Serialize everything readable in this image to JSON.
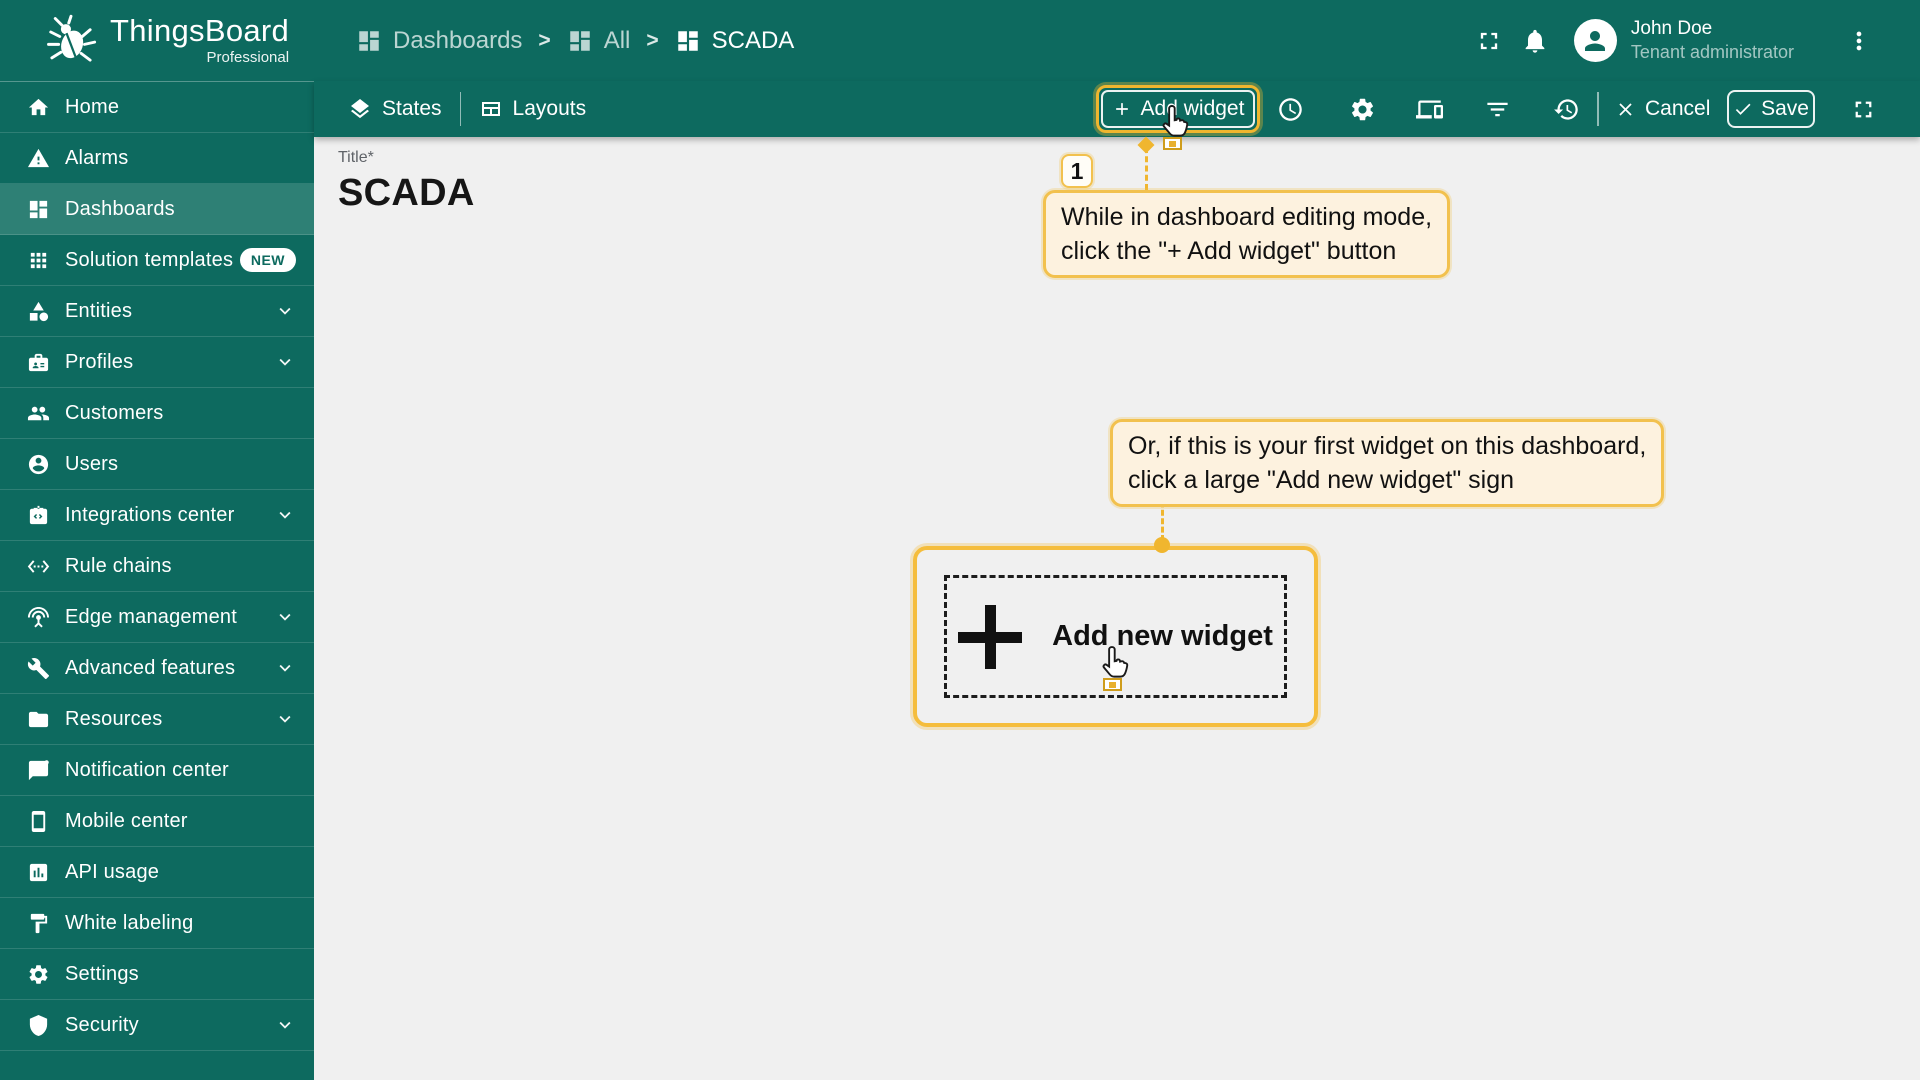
{
  "colors": {
    "primary_teal": "#0d6a5f",
    "selected_teal": "#2e8075",
    "accent_gold": "#f0b62f",
    "callout_bg": "#fdf2df",
    "callout_border": "#f2c14e",
    "content_bg": "#f0f0f0"
  },
  "header": {
    "logo": {
      "title": "ThingsBoard",
      "subtitle": "Professional"
    },
    "separator": ">",
    "breadcrumbs": [
      {
        "label": "Dashboards",
        "muted": true
      },
      {
        "label": "All",
        "muted": true
      },
      {
        "label": "SCADA",
        "muted": false
      }
    ],
    "user": {
      "name": "John Doe",
      "role": "Tenant administrator"
    }
  },
  "sidebar": {
    "items": [
      {
        "label": "Home",
        "icon": "home"
      },
      {
        "label": "Alarms",
        "icon": "warning"
      },
      {
        "label": "Dashboards",
        "icon": "dashboard",
        "selected": true
      },
      {
        "label": "Solution templates",
        "icon": "apps",
        "badge": "NEW"
      },
      {
        "label": "Entities",
        "icon": "category",
        "chevron": true
      },
      {
        "label": "Profiles",
        "icon": "profiles",
        "chevron": true
      },
      {
        "label": "Customers",
        "icon": "people"
      },
      {
        "label": "Users",
        "icon": "account"
      },
      {
        "label": "Integrations center",
        "icon": "integration",
        "chevron": true
      },
      {
        "label": "Rule chains",
        "icon": "code"
      },
      {
        "label": "Edge management",
        "icon": "antenna",
        "chevron": true
      },
      {
        "label": "Advanced features",
        "icon": "build",
        "chevron": true
      },
      {
        "label": "Resources",
        "icon": "folder",
        "chevron": true
      },
      {
        "label": "Notification center",
        "icon": "chat"
      },
      {
        "label": "Mobile center",
        "icon": "phone"
      },
      {
        "label": "API usage",
        "icon": "assessment"
      },
      {
        "label": "White labeling",
        "icon": "paint"
      },
      {
        "label": "Settings",
        "icon": "gear"
      },
      {
        "label": "Security",
        "icon": "shield",
        "chevron": true
      }
    ]
  },
  "toolbar": {
    "states_label": "States",
    "layouts_label": "Layouts",
    "add_widget_label": "Add widget",
    "cancel_label": "Cancel",
    "save_label": "Save"
  },
  "main": {
    "title_label": "Title*",
    "title_value": "SCADA",
    "add_new_widget_label": "Add new widget"
  },
  "tutorial": {
    "step_number": "1",
    "callout1_lines": [
      "While in dashboard editing mode,",
      "click the \"+ Add widget\" button"
    ],
    "callout2_lines": [
      "Or, if this is your first widget on this dashboard,",
      "click a large \"Add new widget\" sign"
    ]
  }
}
